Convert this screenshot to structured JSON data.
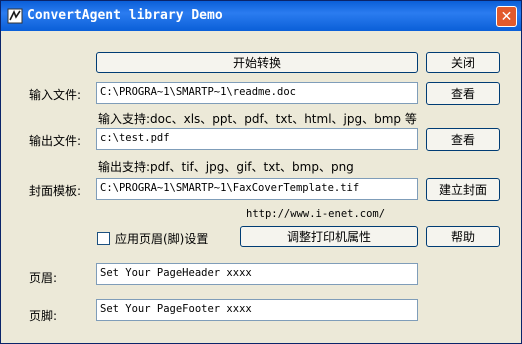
{
  "window": {
    "title": "ConvertAgent library Demo",
    "close_glyph": "✕"
  },
  "buttons": {
    "start": "开始转换",
    "close": "关闭",
    "browse_input": "查看",
    "browse_output": "查看",
    "create_cover": "建立封面",
    "adjust_printer": "调整打印机属性",
    "help": "帮助"
  },
  "fields": {
    "input_file": {
      "label": "输入文件:",
      "value": "C:\\PROGRA~1\\SMARTP~1\\readme.doc"
    },
    "input_support": "输入支持:doc、xls、ppt、pdf、txt、html、jpg、bmp 等",
    "output_file": {
      "label": "输出文件:",
      "value": "c:\\test.pdf"
    },
    "output_support": "输出支持:pdf、tif、jpg、gif、txt、bmp、png",
    "cover_template": {
      "label": "封面模板:",
      "value": "C:\\PROGRA~1\\SMARTP~1\\FaxCoverTemplate.tif"
    },
    "url": "http://www.i-enet.com/",
    "header_footer_checkbox": {
      "label": "应用页眉(脚)设置",
      "checked": false
    },
    "page_header": {
      "label": "页眉:",
      "value": "Set Your PageHeader xxxx"
    },
    "page_footer": {
      "label": "页脚:",
      "value": "Set Your PageFooter xxxx"
    }
  }
}
